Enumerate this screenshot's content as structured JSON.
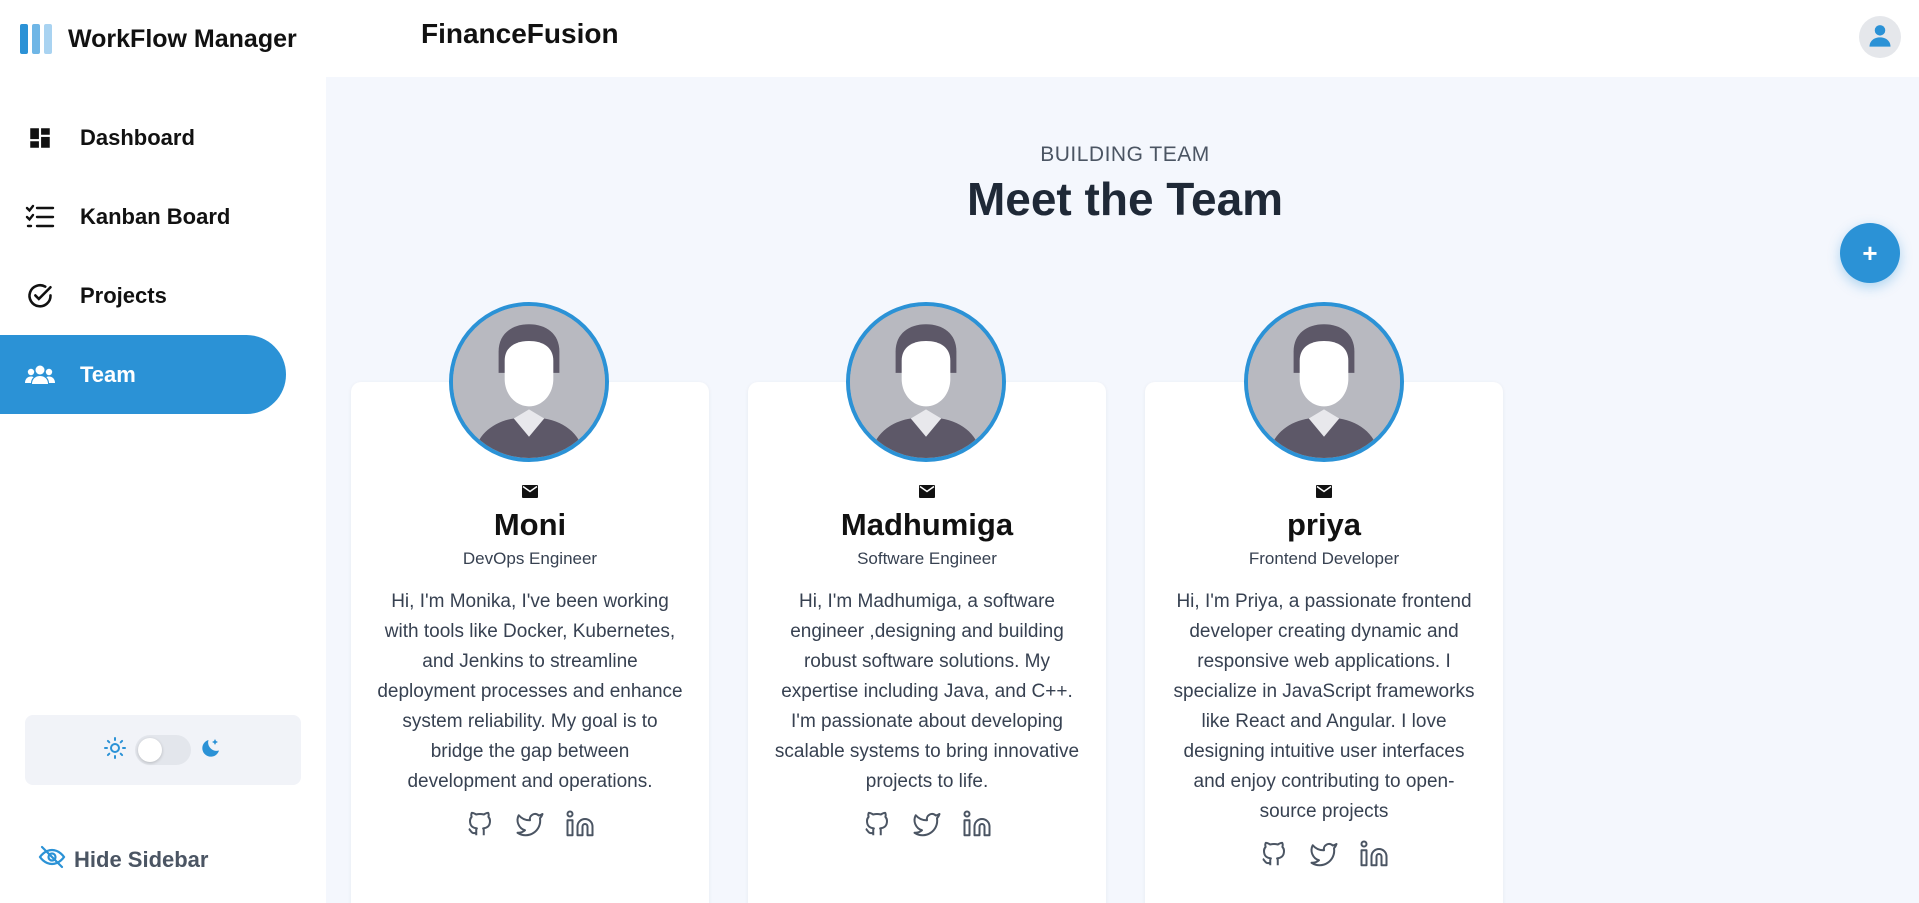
{
  "sidebar": {
    "brand": "WorkFlow Manager",
    "items": [
      {
        "label": "Dashboard",
        "icon": "dashboard-icon"
      },
      {
        "label": "Kanban Board",
        "icon": "checklist-icon"
      },
      {
        "label": "Projects",
        "icon": "check-circle-icon"
      },
      {
        "label": "Team",
        "icon": "team-icon",
        "active": true
      }
    ],
    "hide_label": "Hide Sidebar"
  },
  "header": {
    "title": "FinanceFusion"
  },
  "main": {
    "eyebrow": "BUILDING TEAM",
    "title": "Meet the Team"
  },
  "members": [
    {
      "name": "Moni",
      "role": "DevOps Engineer",
      "bio": "Hi, I'm Monika, I've been working with tools like Docker, Kubernetes, and Jenkins to streamline deployment processes and enhance system reliability. My goal is to bridge the gap between development and operations."
    },
    {
      "name": "Madhumiga",
      "role": "Software Engineer",
      "bio": "Hi, I'm Madhumiga, a software engineer ,designing and building robust software solutions. My expertise including Java, and C++. I'm passionate about developing scalable systems to bring innovative projects to life."
    },
    {
      "name": "priya",
      "role": "Frontend Developer",
      "bio": "Hi, I'm Priya, a passionate frontend developer creating dynamic and responsive web applications. I specialize in JavaScript frameworks like React and Angular. I love designing intuitive user interfaces and enjoy contributing to open-source projects"
    }
  ],
  "fab_label": "+",
  "colors": {
    "accent": "#2b92d6",
    "background": "#f4f7fd",
    "text": "#111111"
  }
}
